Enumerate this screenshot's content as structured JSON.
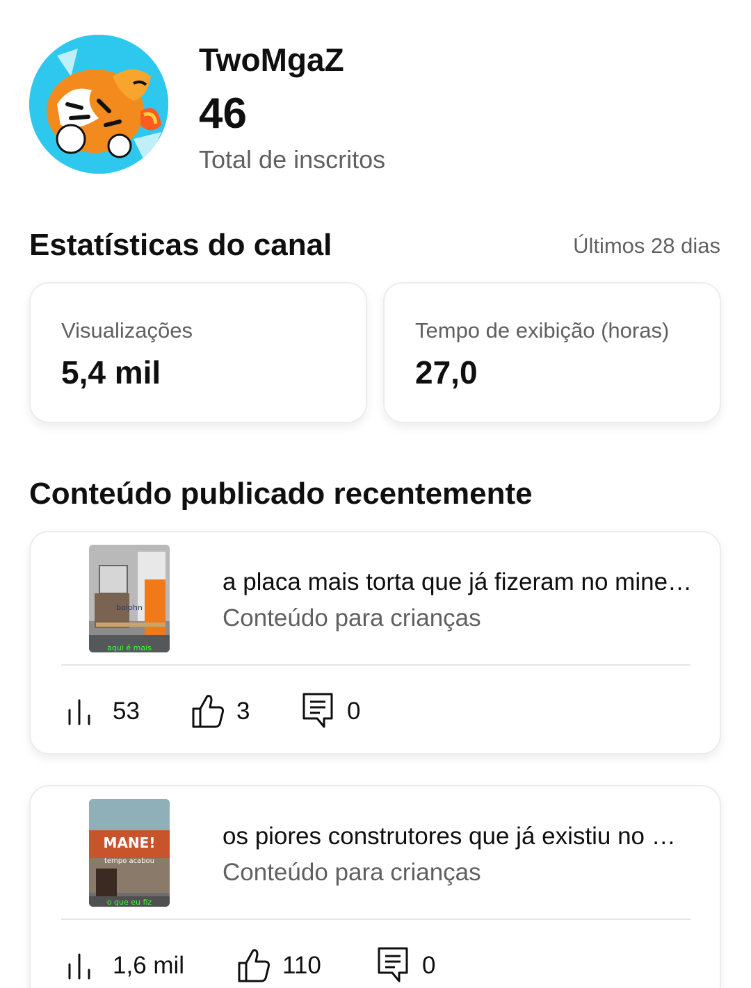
{
  "channel": {
    "name": "TwoMgaZ",
    "subscribers": "46",
    "subscribers_label": "Total de inscritos",
    "avatar_icon": "tiger-logo"
  },
  "stats": {
    "title": "Estatísticas do canal",
    "period": "Últimos 28 dias",
    "metrics": [
      {
        "label": "Visualizações",
        "value": "5,4 mil"
      },
      {
        "label": "Tempo de exibição (horas)",
        "value": "27,0"
      }
    ]
  },
  "recent": {
    "title": "Conteúdo publicado recentemente",
    "items": [
      {
        "title": "a placa mais torta que já fizeram no minecraft",
        "subtitle": "Conteúdo para crianças",
        "thumb_text_1": "bolphn",
        "thumb_text_2": "aqui é mais",
        "views": "53",
        "likes": "3",
        "comments": "0"
      },
      {
        "title": "os piores construtores que já existiu no minecraft",
        "subtitle": "Conteúdo para crianças",
        "thumb_text_1": "MANE!",
        "thumb_text_2": "tempo acabou",
        "thumb_text_3": "o que eu fiz",
        "views": "1,6 mil",
        "likes": "110",
        "comments": "0"
      }
    ]
  },
  "icons": {
    "views": "bar-chart-icon",
    "likes": "thumbs-up-icon",
    "comments": "comment-icon"
  },
  "colors": {
    "text": "#0f0f0f",
    "secondary": "#606060",
    "avatar_bg": "#2ec8ee"
  }
}
